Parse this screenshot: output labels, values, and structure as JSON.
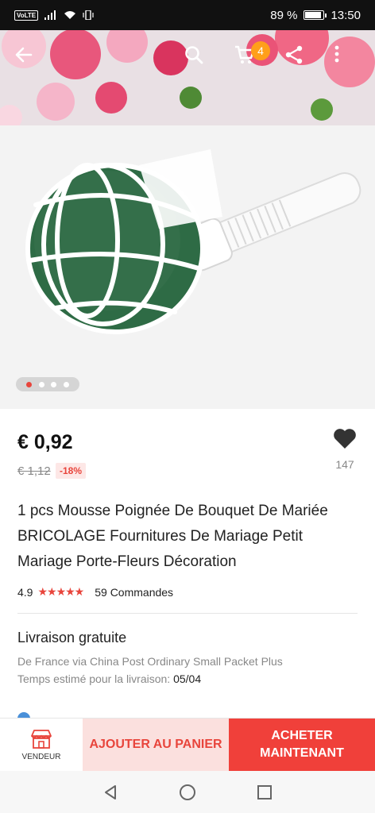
{
  "status_bar": {
    "volte": "VoLTE",
    "battery_percent": "89 %",
    "battery_level": 0.89,
    "time": "13:50"
  },
  "header": {
    "icons": [
      "back-arrow-icon",
      "search-icon",
      "cart-icon",
      "share-icon",
      "more-vert-icon"
    ],
    "cart_count": "4"
  },
  "gallery": {
    "total_images": 4,
    "active_index": 0
  },
  "product": {
    "price": "€ 0,92",
    "old_price": "€ 1,12",
    "discount": "-18%",
    "wishlist_count": "147",
    "title": "1 pcs Mousse Poignée De Bouquet De Mariée BRICOLAGE Fournitures De Mariage Petit Mariage Porte-Fleurs Décoration",
    "rating": "4.9",
    "stars": 5,
    "orders": "59 Commandes"
  },
  "shipping": {
    "title": "Livraison gratuite",
    "from": "De France via China Post Ordinary Small Packet Plus",
    "time_label": "Temps estimé pour la livraison:",
    "time_value": "05/04"
  },
  "actions": {
    "vendor_label": "VENDEUR",
    "add_to_cart": "AJOUTER AU PANIER",
    "buy_now_line1": "ACHETER",
    "buy_now_line2": "MAINTENANT"
  },
  "colors": {
    "accent": "#e8453c",
    "badge": "#ff9f1a"
  }
}
